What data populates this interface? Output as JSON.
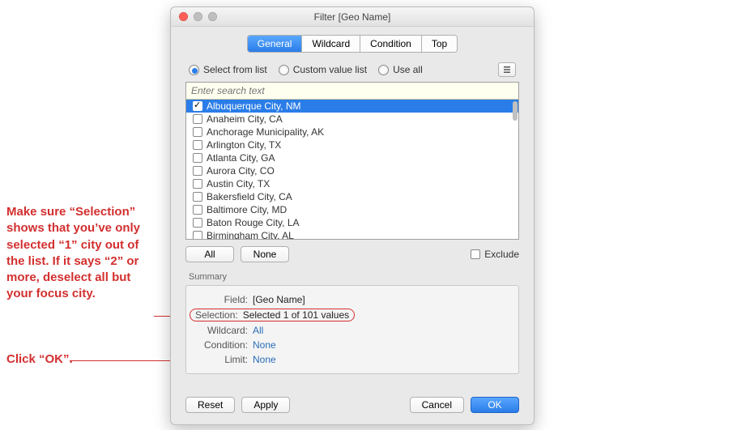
{
  "annotations": {
    "a1": "Make sure “Selection” shows that you’ve only selected “1” city out of the list. If it says “2” or more, deselect all but your focus city.",
    "a2": "Click “OK”."
  },
  "title": "Filter [Geo Name]",
  "tabs": {
    "general": "General",
    "wildcard": "Wildcard",
    "condition": "Condition",
    "top": "Top"
  },
  "mode": {
    "select_from_list": "Select from list",
    "custom_value_list": "Custom value list",
    "use_all": "Use all"
  },
  "search_placeholder": "Enter search text",
  "list": [
    {
      "label": "Albuquerque City, NM",
      "checked": true,
      "selected": true
    },
    {
      "label": "Anaheim City, CA",
      "checked": false,
      "selected": false
    },
    {
      "label": "Anchorage Municipality, AK",
      "checked": false,
      "selected": false
    },
    {
      "label": "Arlington City, TX",
      "checked": false,
      "selected": false
    },
    {
      "label": "Atlanta City, GA",
      "checked": false,
      "selected": false
    },
    {
      "label": "Aurora City, CO",
      "checked": false,
      "selected": false
    },
    {
      "label": "Austin City, TX",
      "checked": false,
      "selected": false
    },
    {
      "label": "Bakersfield City, CA",
      "checked": false,
      "selected": false
    },
    {
      "label": "Baltimore City, MD",
      "checked": false,
      "selected": false
    },
    {
      "label": "Baton Rouge City, LA",
      "checked": false,
      "selected": false
    },
    {
      "label": "Birmingham City, AL",
      "checked": false,
      "selected": false
    }
  ],
  "buttons": {
    "all": "All",
    "none": "None",
    "exclude": "Exclude",
    "reset": "Reset",
    "apply": "Apply",
    "cancel": "Cancel",
    "ok": "OK"
  },
  "summary_heading": "Summary",
  "summary": {
    "field_lbl": "Field:",
    "field_val": "[Geo Name]",
    "selection_lbl": "Selection:",
    "selection_val": "Selected 1 of 101 values",
    "wildcard_lbl": "Wildcard:",
    "wildcard_val": "All",
    "condition_lbl": "Condition:",
    "condition_val": "None",
    "limit_lbl": "Limit:",
    "limit_val": "None"
  }
}
